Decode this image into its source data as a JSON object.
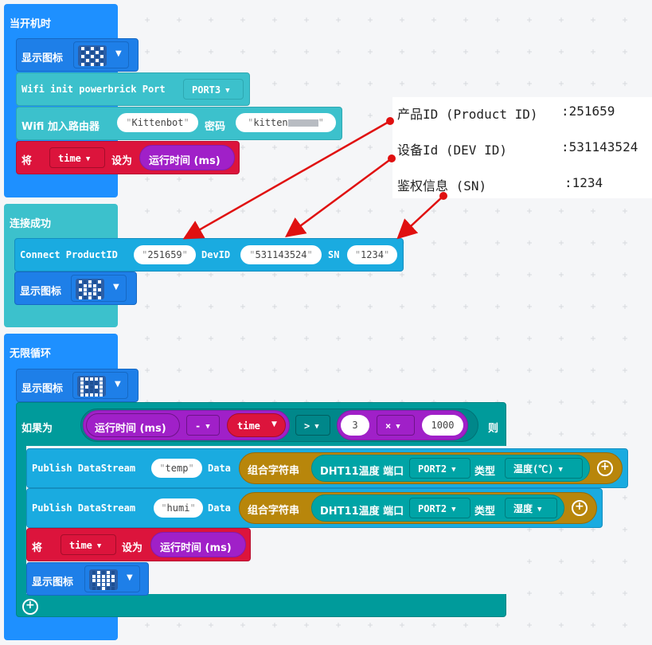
{
  "on_start": {
    "hat_label": "当开机时",
    "show_icon_label": "显示图标",
    "wifi_init": {
      "label": "Wifi init powerbrick Port",
      "port": "PORT3"
    },
    "wifi_join": {
      "label": "Wifi 加入路由器",
      "ssid": "Kittenbot",
      "pwd_label": "密码",
      "password": "kitten"
    },
    "set_var": {
      "label": "将",
      "var": "time",
      "to": "设为",
      "value": "运行时间 (ms)"
    }
  },
  "on_connected": {
    "hat_label": "连接成功",
    "connect": {
      "label": "Connect ProductID",
      "product_id": "251659",
      "dev_label": "DevID",
      "dev_id": "531143524",
      "sn_label": "SN",
      "sn": "1234"
    },
    "show_icon_label": "显示图标"
  },
  "forever": {
    "hat_label": "无限循环",
    "show_icon_label": "显示图标",
    "if_block": {
      "if_label": "如果为",
      "runtime": "运行时间 (ms)",
      "minus": "-",
      "var": "time",
      "compare": ">",
      "num_a": "3",
      "times": "×",
      "num_b": "1000",
      "then_label": "则"
    },
    "publish_temp": {
      "label": "Publish DataStream",
      "stream": "temp",
      "data_label": "Data",
      "join": "组合字符串",
      "sensor": "DHT11温度 端口",
      "port": "PORT2",
      "type_label": "类型",
      "type": "温度(℃)"
    },
    "publish_humi": {
      "label": "Publish DataStream",
      "stream": "humi",
      "data_label": "Data",
      "join": "组合字符串",
      "sensor": "DHT11温度 端口",
      "port": "PORT2",
      "type_label": "类型",
      "type": "湿度"
    },
    "set_var": {
      "label": "将",
      "var": "time",
      "to": "设为",
      "value": "运行时间 (ms)"
    },
    "show_icon_label2": "显示图标"
  },
  "callout": {
    "product_label": "产品ID (Product ID)",
    "product_value": ":251659",
    "dev_label": "设备Id (DEV ID)",
    "dev_value": ":531143524",
    "sn_label": "鉴权信息 (SN)",
    "sn_value": ":1234"
  },
  "colors": {
    "hat_blue": "#1e90ff",
    "teal": "#00a4a6",
    "wifi": "#3cc1cc",
    "var_red": "#dc143c",
    "purple": "#a020c8",
    "logic_teal": "#009b9b",
    "publish_blue": "#1aabe0",
    "join_gold": "#b8860b",
    "arrow_red": "#e01010"
  }
}
